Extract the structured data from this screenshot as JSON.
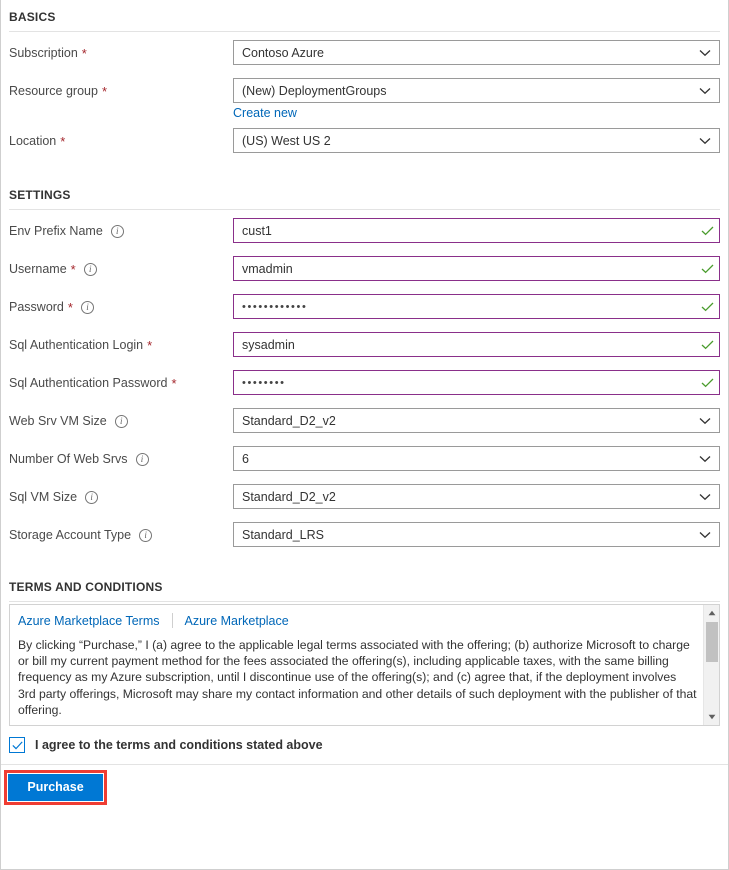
{
  "basics": {
    "heading": "BASICS",
    "fields": [
      {
        "label": "Subscription",
        "required": true,
        "info": false,
        "type": "select",
        "value": "Contoso Azure"
      },
      {
        "label": "Resource group",
        "required": true,
        "info": false,
        "type": "select",
        "value": "(New) DeploymentGroups",
        "sublink": "Create new"
      },
      {
        "label": "Location",
        "required": true,
        "info": false,
        "type": "select",
        "value": "(US) West US 2"
      }
    ]
  },
  "settings": {
    "heading": "SETTINGS",
    "fields": [
      {
        "label": "Env Prefix Name",
        "required": false,
        "info": true,
        "type": "text",
        "value": "cust1",
        "valid": true
      },
      {
        "label": "Username",
        "required": true,
        "info": true,
        "type": "text",
        "value": "vmadmin",
        "valid": true
      },
      {
        "label": "Password",
        "required": true,
        "info": true,
        "type": "password",
        "value": "••••••••••••",
        "valid": true
      },
      {
        "label": "Sql Authentication Login",
        "required": true,
        "info": false,
        "type": "text",
        "value": "sysadmin",
        "valid": true
      },
      {
        "label": "Sql Authentication Password",
        "required": true,
        "info": false,
        "type": "password",
        "value": "••••••••",
        "valid": true
      },
      {
        "label": "Web Srv VM Size",
        "required": false,
        "info": true,
        "type": "select",
        "value": "Standard_D2_v2"
      },
      {
        "label": "Number Of Web Srvs",
        "required": false,
        "info": true,
        "type": "select",
        "value": "6"
      },
      {
        "label": "Sql VM Size",
        "required": false,
        "info": true,
        "type": "select",
        "value": "Standard_D2_v2"
      },
      {
        "label": "Storage Account Type",
        "required": false,
        "info": true,
        "type": "select",
        "value": "Standard_LRS"
      }
    ]
  },
  "terms": {
    "heading": "TERMS AND CONDITIONS",
    "link_marketplace_terms": "Azure Marketplace Terms",
    "link_marketplace": "Azure Marketplace",
    "body": "By clicking “Purchase,” I (a) agree to the applicable legal terms associated with the offering; (b) authorize Microsoft to charge or bill my current payment method for the fees associated the offering(s), including applicable taxes, with the same billing frequency as my Azure subscription, until I discontinue use of the offering(s); and (c) agree that, if the deployment involves 3rd party offerings, Microsoft may share my contact information and other details of such deployment with the publisher of that offering.",
    "agree_label": "I agree to the terms and conditions stated above",
    "agree_checked": true
  },
  "footer": {
    "purchase_label": "Purchase",
    "purchase_highlighted": true
  },
  "colors": {
    "accent_blue": "#0078d4",
    "link_blue": "#0067b8",
    "valid_border_purple": "#8a2f8a",
    "valid_check_green": "#4a9c2d",
    "required_red": "#a4262c",
    "highlight_red": "#ef3d33"
  },
  "icons": {
    "info": "i",
    "chevron_down": "chevron-down-icon",
    "checkmark": "checkmark-icon"
  }
}
